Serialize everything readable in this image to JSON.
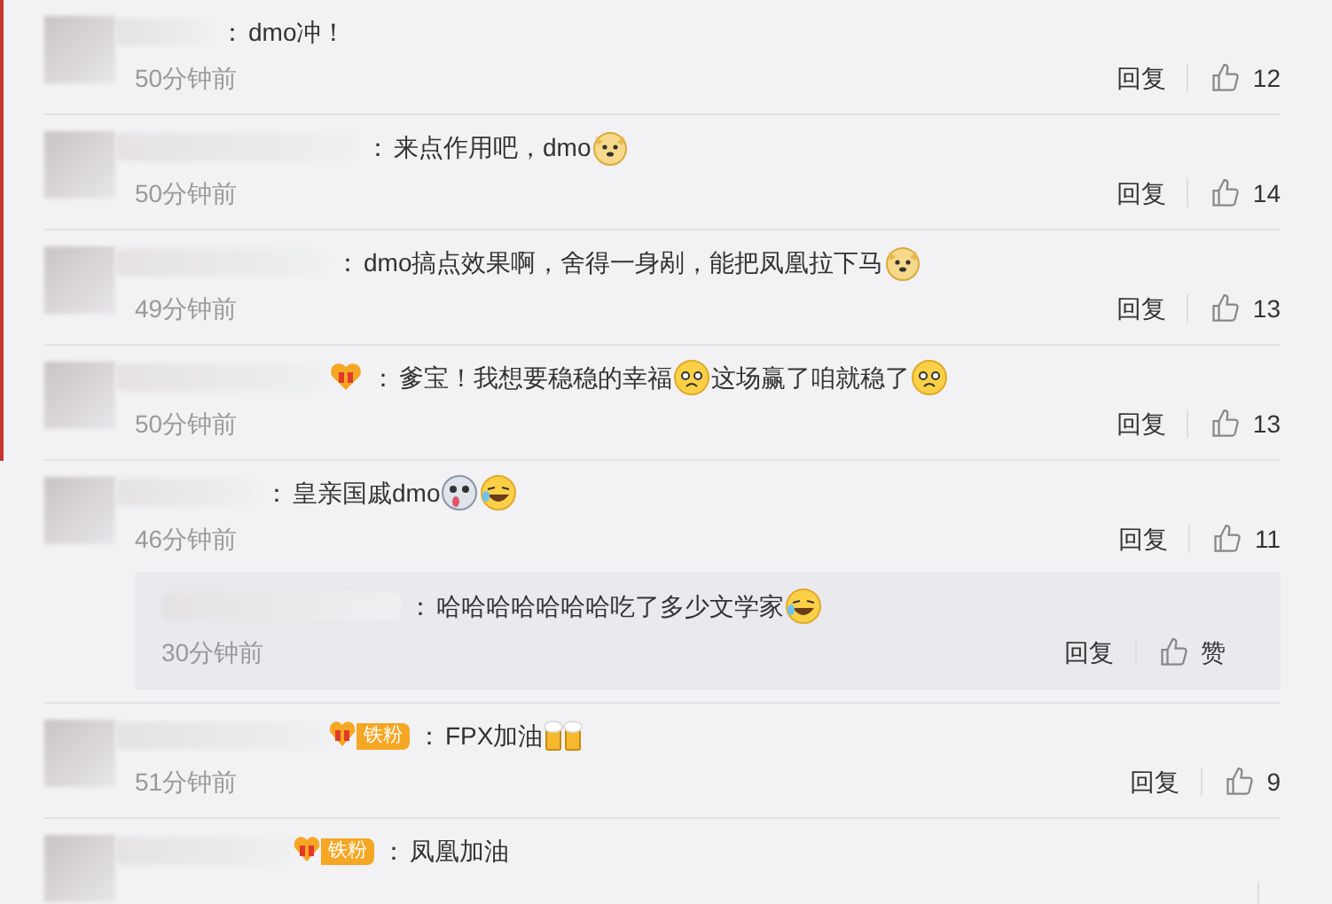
{
  "comments": [
    {
      "kind": "plain",
      "separator": "：",
      "segments": [
        {
          "kind": "text",
          "text": "dmo冲！"
        }
      ],
      "time": "50分钟前",
      "reply": "回复",
      "likes": "12"
    },
    {
      "kind": "plain",
      "separator": "：",
      "segments": [
        {
          "kind": "text",
          "text": "来点作用吧，dmo"
        },
        {
          "kind": "doge"
        }
      ],
      "time": "50分钟前",
      "reply": "回复",
      "likes": "14"
    },
    {
      "kind": "plain",
      "separator": "：",
      "segments": [
        {
          "kind": "text",
          "text": "dmo搞点效果啊，舍得一身剐，能把凤凰拉下马"
        },
        {
          "kind": "doge"
        }
      ],
      "time": "49分钟前",
      "reply": "回复",
      "likes": "13"
    },
    {
      "kind": "fan",
      "separator": "：",
      "segments": [
        {
          "kind": "text",
          "text": "爹宝！我想要稳稳的幸福"
        },
        {
          "kind": "sad"
        },
        {
          "kind": "text",
          "text": "这场赢了咱就稳了"
        },
        {
          "kind": "sad"
        }
      ],
      "time": "50分钟前",
      "reply": "回复",
      "likes": "13"
    },
    {
      "kind": "plain",
      "separator": "：",
      "segments": [
        {
          "kind": "text",
          "text": "皇亲国戚dmo"
        },
        {
          "kind": "husky"
        },
        {
          "kind": "laugh"
        }
      ],
      "time": "46分钟前",
      "reply": "回复",
      "likes": "11",
      "replies": [
        {
          "separator": "：",
          "segments": [
            {
              "kind": "text",
              "text": "哈哈哈哈哈哈哈吃了多少文学家"
            },
            {
              "kind": "laugh"
            }
          ],
          "time": "30分钟前",
          "reply": "回复",
          "likes": "赞"
        }
      ]
    },
    {
      "kind": "tiefen",
      "badge_text": "铁粉",
      "separator": "：",
      "segments": [
        {
          "kind": "text",
          "text": "FPX加油"
        },
        {
          "kind": "beer"
        }
      ],
      "time": "51分钟前",
      "reply": "回复",
      "likes": "9"
    },
    {
      "kind": "tiefen",
      "badge_text": "铁粉",
      "separator": "：",
      "segments": [
        {
          "kind": "text",
          "text": "凤凰加油"
        }
      ]
    }
  ]
}
